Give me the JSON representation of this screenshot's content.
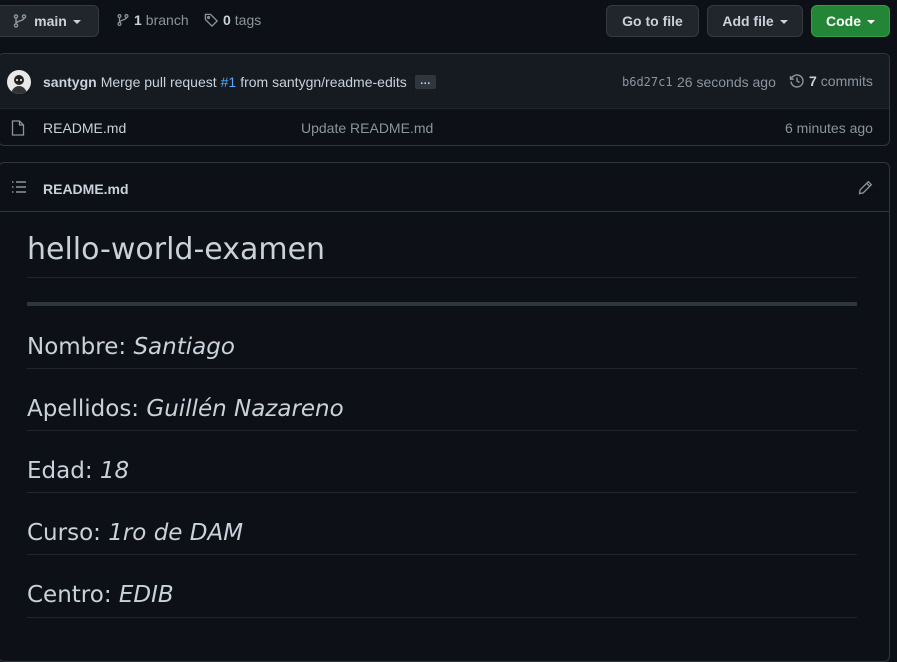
{
  "toolbar": {
    "branch_selector": "main",
    "branch_count": "1",
    "branch_label": "branch",
    "tag_count": "0",
    "tag_label": "tags",
    "go_to_file": "Go to file",
    "add_file": "Add file",
    "code": "Code"
  },
  "commit": {
    "author": "santygn",
    "message_prefix": "Merge pull request",
    "pr_link": "#1",
    "message_suffix": "from santygn/readme-edits",
    "ellipsis": "…",
    "hash": "b6d27c1",
    "time": "26 seconds ago",
    "commits_count": "7",
    "commits_label": "commits"
  },
  "files": [
    {
      "name": "README.md",
      "message": "Update README.md",
      "time": "6 minutes ago"
    }
  ],
  "readme": {
    "header_title": "README.md",
    "title": "hello-world-examen",
    "fields": [
      {
        "label": "Nombre:",
        "value": "Santiago"
      },
      {
        "label": "Apellidos:",
        "value": "Guillén Nazareno"
      },
      {
        "label": "Edad:",
        "value": "18"
      },
      {
        "label": "Curso:",
        "value": "1ro de DAM"
      },
      {
        "label": "Centro:",
        "value": "EDIB"
      }
    ]
  },
  "colors": {
    "background": "#0d1117",
    "border": "#30363d",
    "accent_link": "#58a6ff",
    "code_button": "#238636"
  },
  "icons": [
    "branch-icon",
    "tag-icon",
    "history-icon",
    "file-icon",
    "list-icon",
    "pencil-icon"
  ]
}
